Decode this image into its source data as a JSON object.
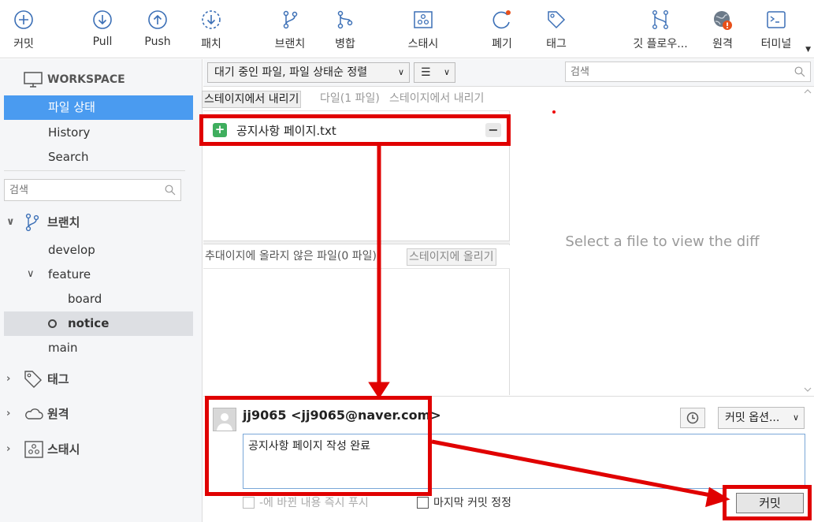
{
  "toolbar": {
    "commit": "커밋",
    "pull": "Pull",
    "push": "Push",
    "fetch": "패치",
    "branch": "브랜치",
    "merge": "병합",
    "stash": "스태시",
    "discard": "폐기",
    "tag": "태그",
    "git_flow": "깃 플로우...",
    "remote": "원격",
    "terminal": "터미널"
  },
  "sidebar": {
    "workspace_title": "WORKSPACE",
    "workspace_items": [
      "파일 상태",
      "History",
      "Search"
    ],
    "search_placeholder": "검색",
    "branches_title": "브랜치",
    "branches": {
      "develop": "develop",
      "feature": "feature",
      "board": "board",
      "notice": "notice",
      "main": "main"
    },
    "tags_title": "태그",
    "remotes_title": "원격",
    "stash_title": "스태시"
  },
  "file_area": {
    "sort_dropdown": "대기 중인 파일, 파일 상태순 정렬",
    "view_dropdown": "☰",
    "search_placeholder": "검색",
    "staged_header": {
      "button": "스테이지에서 내리기",
      "ghost_middle": "다일(1 파일)",
      "ghost_right": "스테이지에서 내리기"
    },
    "staged_files": [
      {
        "name": "공지사항 페이지.txt",
        "status_color": "#3fae5e"
      }
    ],
    "unstaged_header": {
      "ghost_text": "추대이지에 올라지 않은 파일(0 파일)",
      "ghost_right": "스테이지에 올리기"
    }
  },
  "diff": {
    "placeholder": "Select a file to view the diff"
  },
  "commit": {
    "author": "jj9065  <jj9065@naver.com>",
    "options_button": "커밋 옵션...",
    "message": "공지사항 페이지 작성 완료",
    "push_immediately": "-에 바뀐 내용 즉시 푸시",
    "amend_last": "마지막 커밋 정정",
    "commit_button": "커밋"
  },
  "colors": {
    "accent": "#4a9bf0",
    "annotation": "#e00000",
    "added": "#3fae5e",
    "remote_alert": "#e8501a"
  }
}
